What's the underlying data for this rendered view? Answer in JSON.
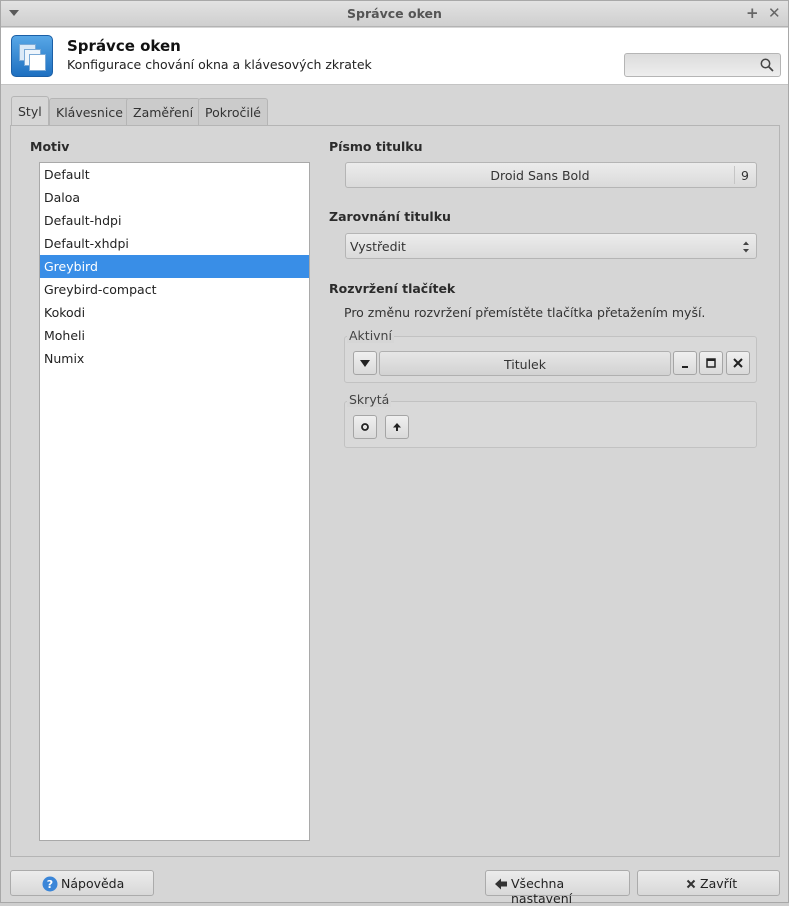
{
  "window": {
    "title": "Správce oken"
  },
  "header": {
    "title": "Správce oken",
    "subtitle": "Konfigurace chování okna a klávesových zkratek",
    "search_placeholder": ""
  },
  "tabs": [
    {
      "label": "Styl",
      "active": true
    },
    {
      "label": "Klávesnice",
      "active": false
    },
    {
      "label": "Zaměření",
      "active": false
    },
    {
      "label": "Pokročilé",
      "active": false
    }
  ],
  "theme": {
    "label": "Motiv",
    "items": [
      "Default",
      "Daloa",
      "Default-hdpi",
      "Default-xhdpi",
      "Greybird",
      "Greybird-compact",
      "Kokodi",
      "Moheli",
      "Numix"
    ],
    "selected": "Greybird"
  },
  "title_font": {
    "label": "Písmo titulku",
    "font_name": "Droid Sans Bold",
    "font_size": "9"
  },
  "title_alignment": {
    "label": "Zarovnání titulku",
    "value": "Vystředit"
  },
  "button_layout": {
    "label": "Rozvržení tlačítek",
    "hint": "Pro změnu rozvržení přemístěte tlačítka přetažením myší.",
    "active_label": "Aktivní",
    "title_button": "Titulek",
    "hidden_label": "Skrytá"
  },
  "footer": {
    "help": "Nápověda",
    "all_settings": "Všechna nastavení",
    "close": "Zavřít"
  },
  "colors": {
    "selection": "#398ee7",
    "accent": "#1e70c1"
  }
}
